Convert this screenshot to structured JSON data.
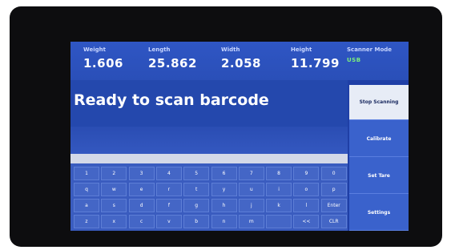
{
  "metrics": [
    {
      "label": "Weight",
      "value": "1.606"
    },
    {
      "label": "Length",
      "value": "25.862"
    },
    {
      "label": "Width",
      "value": "2.058"
    },
    {
      "label": "Height",
      "value": "11.799"
    }
  ],
  "scanner_mode": {
    "label": "Scanner Mode",
    "value": "USB"
  },
  "status": {
    "text": "Ready to scan barcode"
  },
  "side_buttons": [
    {
      "label": "Stop Scanning",
      "active": true
    },
    {
      "label": "Calibrate"
    },
    {
      "label": "Set Tare"
    },
    {
      "label": "Settings"
    }
  ],
  "keyboard": {
    "rows": [
      [
        "1",
        "2",
        "3",
        "4",
        "5",
        "6",
        "7",
        "8",
        "9",
        "0"
      ],
      [
        "q",
        "w",
        "e",
        "r",
        "t",
        "y",
        "u",
        "i",
        "o",
        "p"
      ],
      [
        "a",
        "s",
        "d",
        "f",
        "g",
        "h",
        "j",
        "k",
        "l",
        "Enter"
      ],
      [
        "z",
        "x",
        "c",
        "v",
        "b",
        "n",
        "m",
        "",
        "<<",
        "CLR"
      ]
    ]
  },
  "colors": {
    "screen_bg": "#1f3fa6",
    "mode_value": "#7df07d",
    "active_button": "#e7ecf6"
  }
}
